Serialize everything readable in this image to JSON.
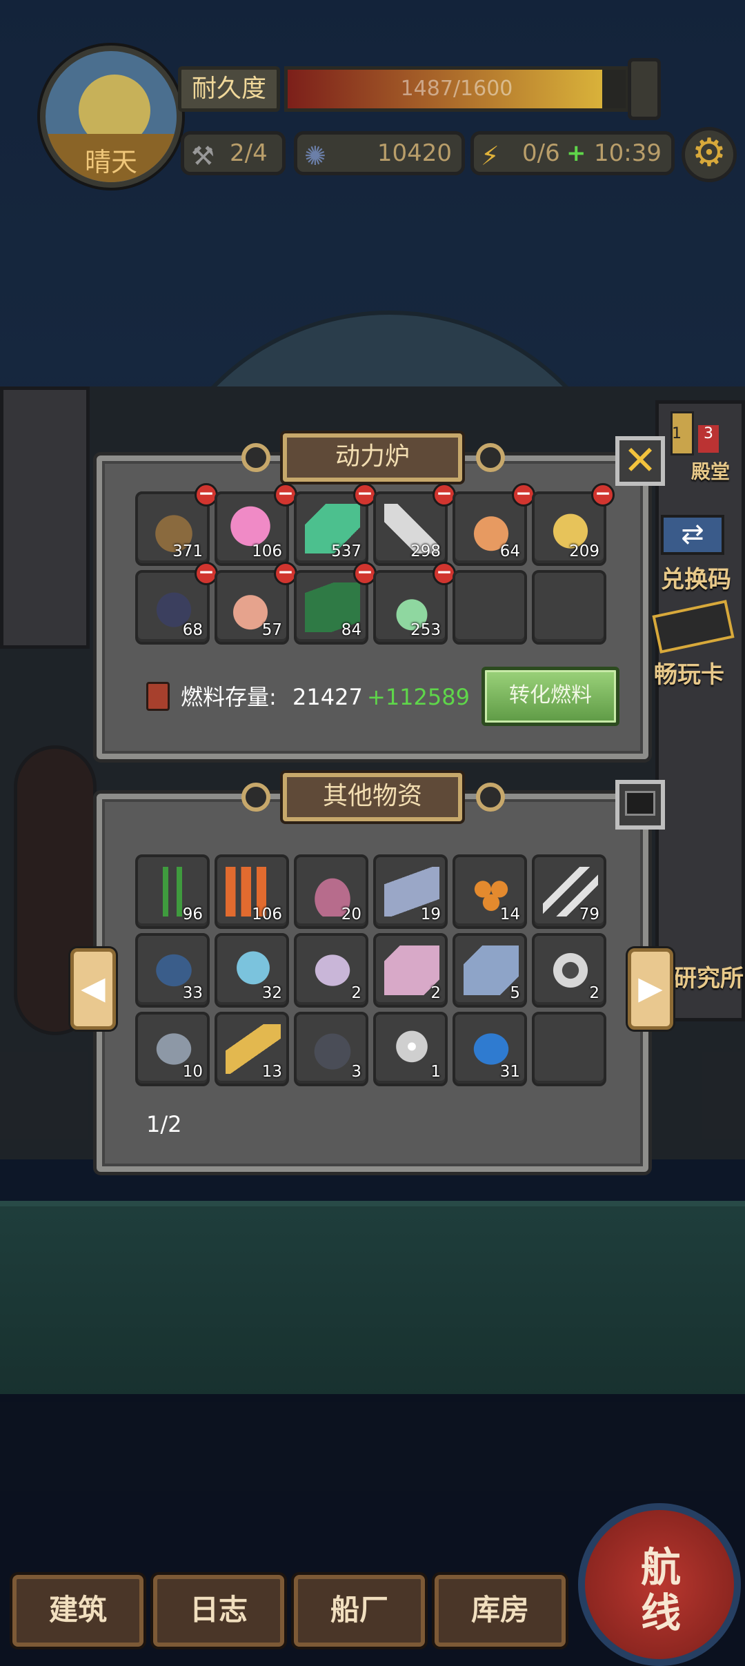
{
  "weather": {
    "label": "晴天"
  },
  "durability": {
    "label": "耐久度",
    "value": "1487/1600",
    "fraction": 0.93
  },
  "stats": {
    "tools": "2/4",
    "currency": "10420",
    "energy": "0/6",
    "energy_plus": "+",
    "timer": "10:39"
  },
  "side": {
    "hall": "殿堂",
    "badge_a": "1",
    "badge_b": "3",
    "redeem": "兑换码",
    "card": "畅玩卡",
    "research": "研究所"
  },
  "reactor": {
    "title": "动力炉",
    "items": [
      {
        "icon": "dung-icon",
        "qty": "371"
      },
      {
        "icon": "pink-dragon-orb-icon",
        "qty": "106"
      },
      {
        "icon": "green-crystal-icon",
        "qty": "537"
      },
      {
        "icon": "bone-tusk-icon",
        "qty": "298"
      },
      {
        "icon": "copper-ore-icon",
        "qty": "64"
      },
      {
        "icon": "ammonite-shell-icon",
        "qty": "209"
      },
      {
        "icon": "dark-helmet-icon",
        "qty": "68"
      },
      {
        "icon": "flame-feather-icon",
        "qty": "57"
      },
      {
        "icon": "circuit-board-icon",
        "qty": "84"
      },
      {
        "icon": "potion-bottle-icon",
        "qty": "253"
      }
    ],
    "fuel_label": "燃料存量:",
    "fuel_value": "21427",
    "fuel_gain": "+112589",
    "convert_label": "转化燃料"
  },
  "supplies": {
    "title": "其他物资",
    "items": [
      {
        "icon": "seaweed-icon",
        "qty": "96"
      },
      {
        "icon": "coral-icon",
        "qty": "106"
      },
      {
        "icon": "meat-chunk-icon",
        "qty": "20"
      },
      {
        "icon": "fish-scale-icon",
        "qty": "19"
      },
      {
        "icon": "fish-roe-icon",
        "qty": "14"
      },
      {
        "icon": "fish-bones-icon",
        "qty": "79"
      },
      {
        "icon": "mussels-icon",
        "qty": "33"
      },
      {
        "icon": "jellyfish-icon",
        "qty": "32"
      },
      {
        "icon": "shell-icon",
        "qty": "2"
      },
      {
        "icon": "pink-cube-icon",
        "qty": "2"
      },
      {
        "icon": "steel-ingot-icon",
        "qty": "5"
      },
      {
        "icon": "porthole-icon",
        "qty": "2"
      },
      {
        "icon": "grey-clam-icon",
        "qty": "10"
      },
      {
        "icon": "golden-fin-icon",
        "qty": "13"
      },
      {
        "icon": "coal-block-icon",
        "qty": "3"
      },
      {
        "icon": "pearl-icon",
        "qty": "1"
      },
      {
        "icon": "blue-egg-icon",
        "qty": "31"
      }
    ],
    "page": "1/2"
  },
  "nav": {
    "build": "建筑",
    "log": "日志",
    "shipyard": "船厂",
    "warehouse": "库房",
    "route": "航线"
  },
  "colors": {
    "minus": "#d1352f",
    "gain": "#5fd64a",
    "accent": "#c7a86b"
  }
}
